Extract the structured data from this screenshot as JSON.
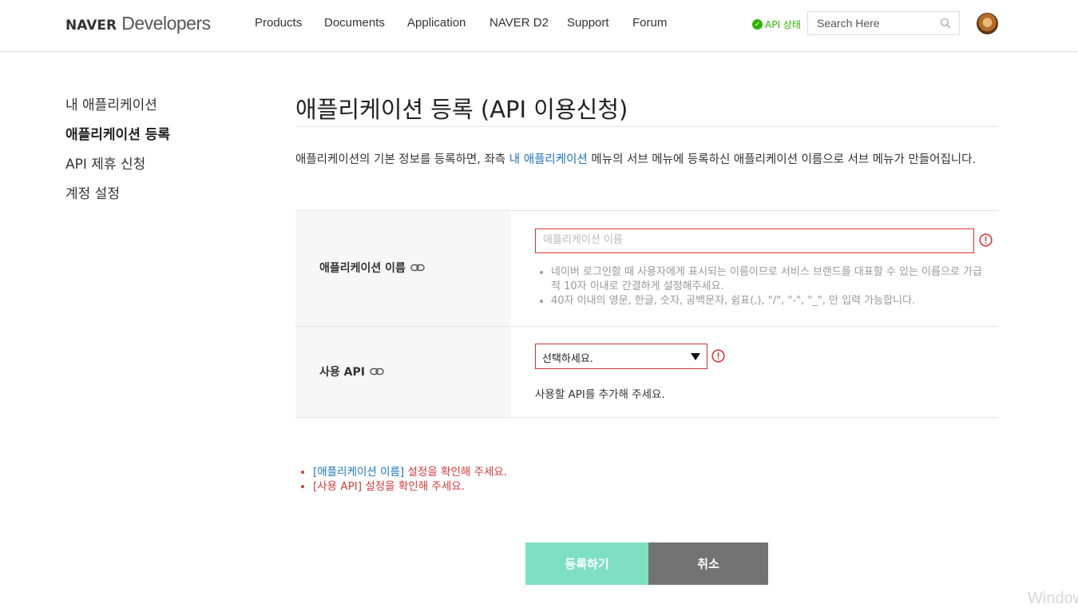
{
  "header": {
    "logo_brand": "NAVER",
    "logo_product": "Developers",
    "nav": [
      "Products",
      "Documents",
      "Application",
      "NAVER D2",
      "Support",
      "Forum"
    ],
    "api_status": "API 상태",
    "search_placeholder": "Search Here"
  },
  "sidebar": {
    "items": [
      "내 애플리케이션",
      "애플리케이션 등록",
      "API 제휴 신청",
      "계정 설정"
    ],
    "active_index": 1
  },
  "main": {
    "title": "애플리케이션 등록 (API 이용신청)",
    "desc_before": "애플리케이션의 기본 정보를 등록하면, 좌측 ",
    "desc_link": "내 애플리케이션",
    "desc_after": " 메뉴의 서브 메뉴에 등록하신 애플리케이션 이름으로 서브 메뉴가 만들어집니다.",
    "form": {
      "app_name_label": "애플리케이션 이름",
      "app_name_value": "",
      "app_name_placeholder": "애플리케이션 이름",
      "app_name_hints": [
        "네이버 로그인할 때 사용자에게 표시되는 이름이므로 서비스 브랜드를 대표할 수 있는 이름으로 가급적 10자 이내로 간결하게 설정해주세요.",
        "40자 이내의 영문, 한글, 숫자, 공백문자, 쉼표(,), \"/\", \"-\", \"_\", 만 입력 가능합니다."
      ],
      "api_label": "사용 API",
      "api_select_value": "선택하세요.",
      "api_help": "사용할 API를 추가해 주세요."
    },
    "errors": [
      {
        "field": "[애플리케이션 이름]",
        "message": " 설정을 확인해 주세요."
      },
      {
        "field": "[사용 API]",
        "message": " 설정을 확인해 주세요."
      }
    ],
    "buttons": {
      "register": "등록하기",
      "cancel": "취소"
    }
  },
  "watermark": "Window",
  "colors": {
    "accent_link": "#1e73be",
    "error_red": "#d23c3c",
    "register_button": "#7fe0c1",
    "cancel_button": "#737373",
    "status_green": "#2db400"
  }
}
